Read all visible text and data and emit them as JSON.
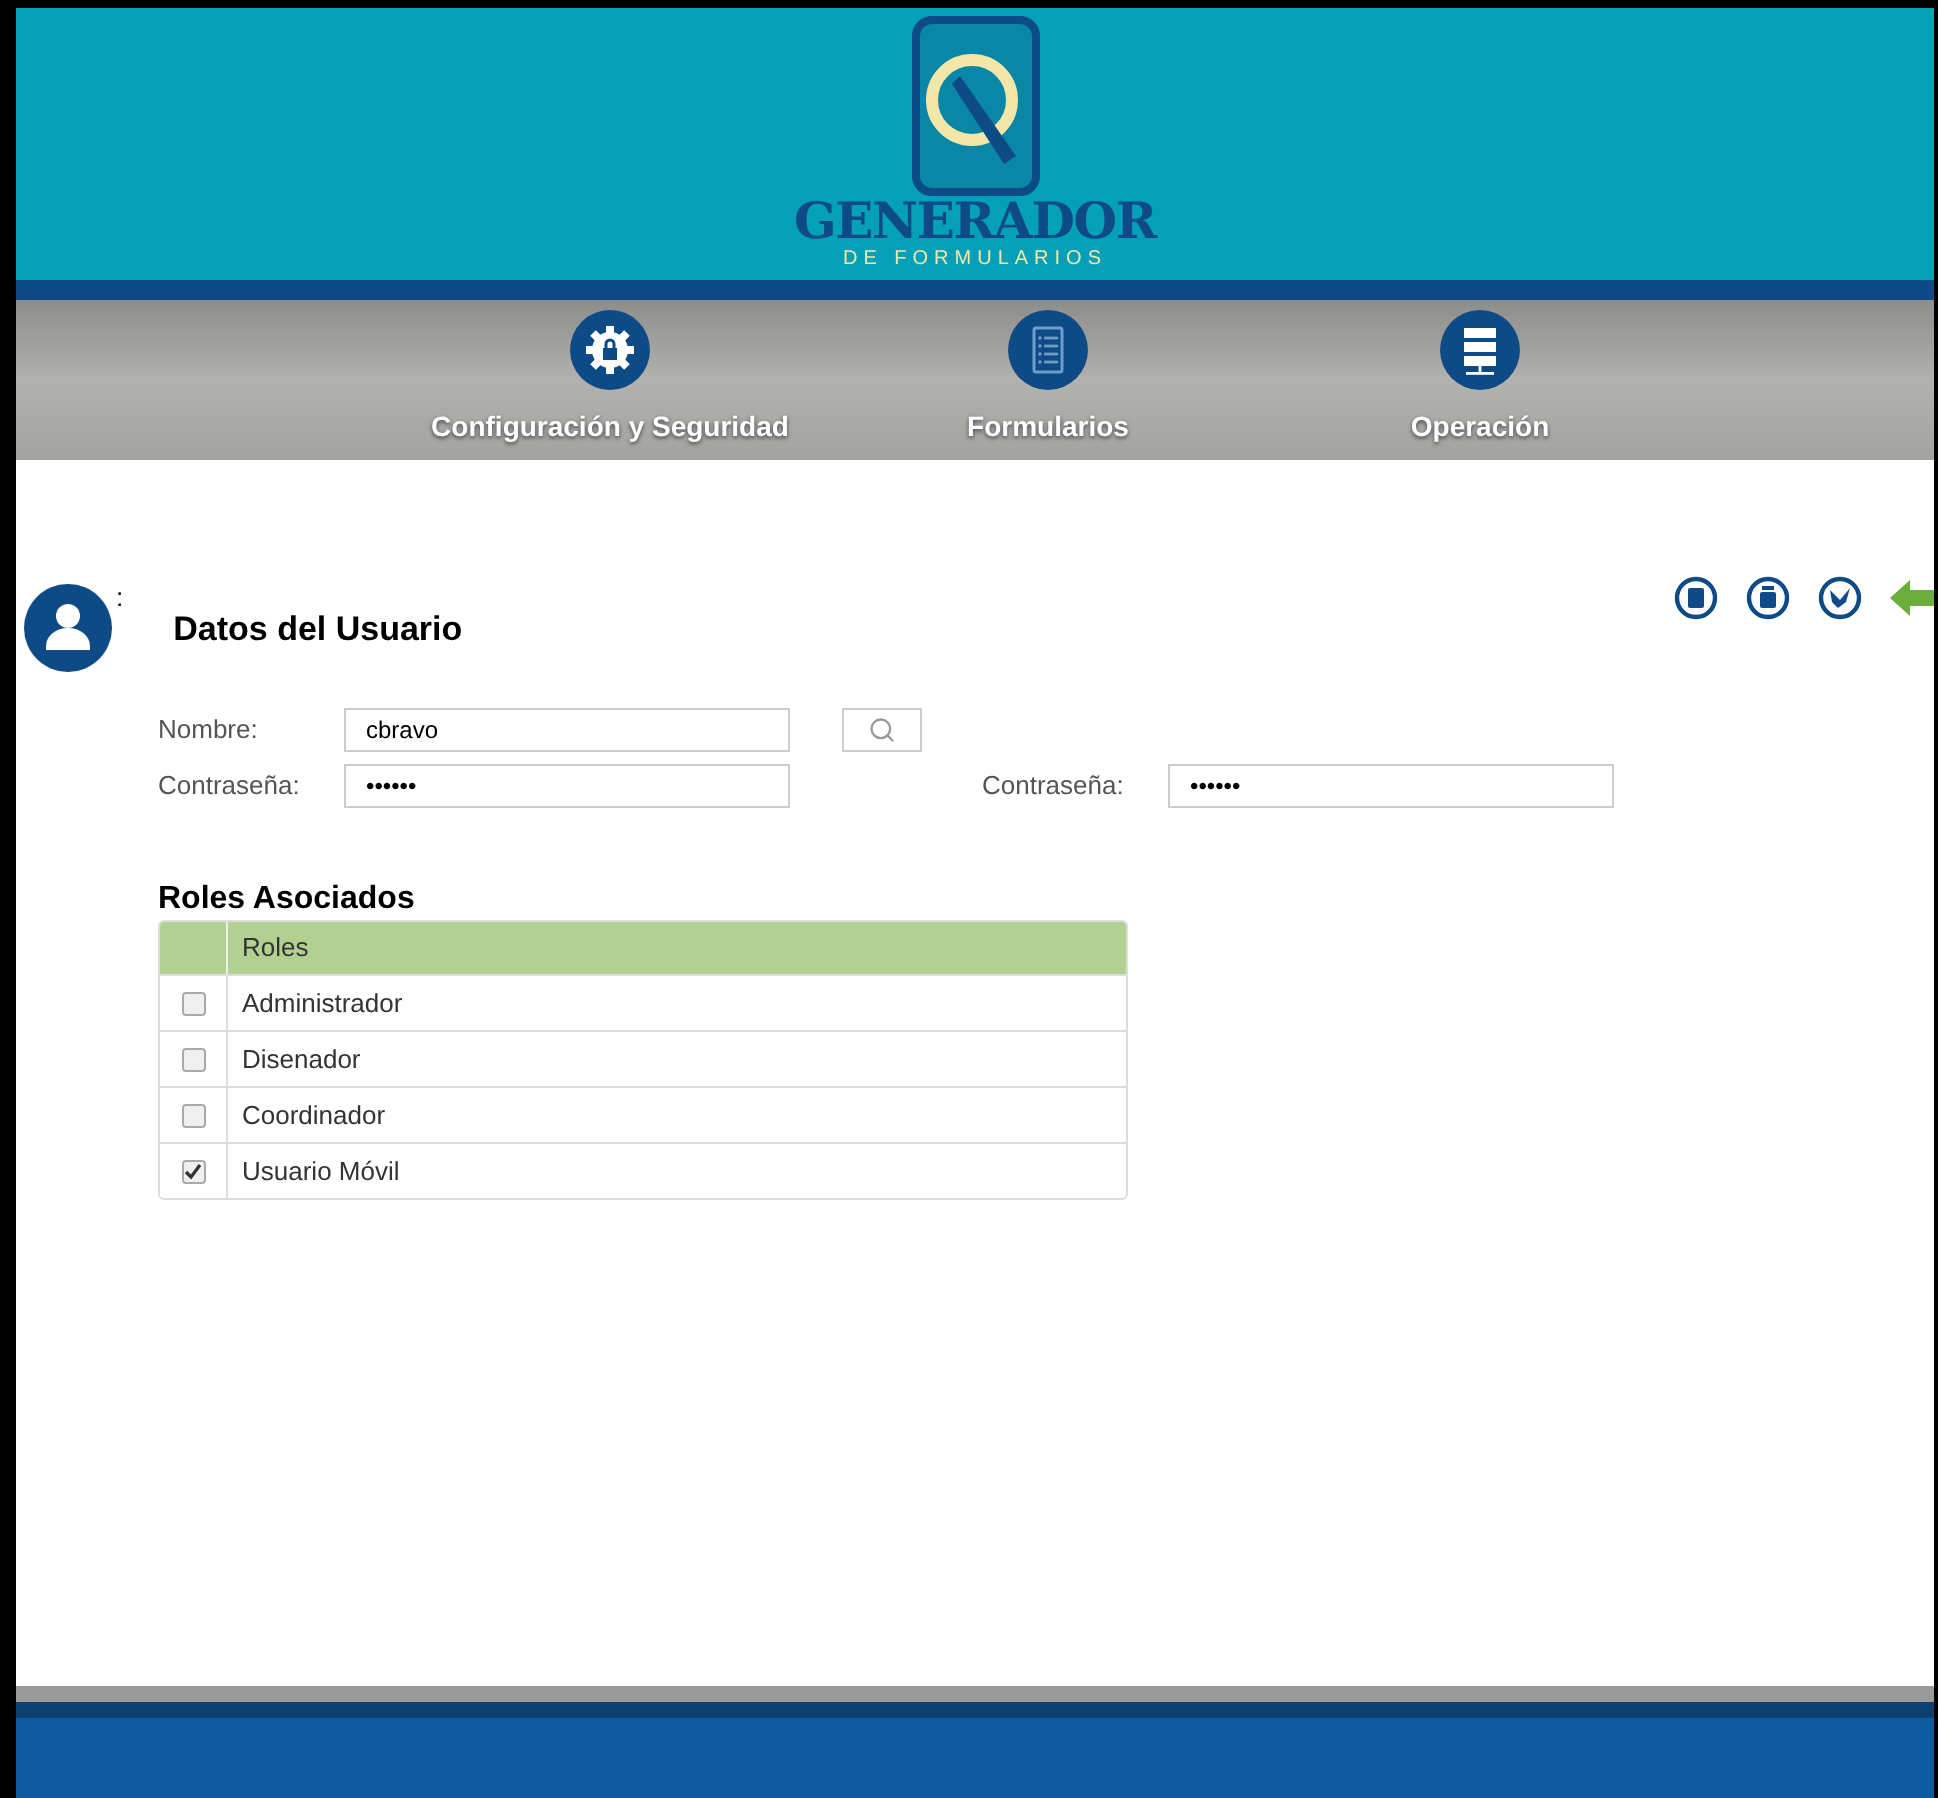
{
  "logo": {
    "title": "GENERADOR",
    "subtitle": "DE FORMULARIOS"
  },
  "nav": [
    {
      "label": "Configuración y Seguridad",
      "kind": "gear"
    },
    {
      "label": "Formularios",
      "kind": "document"
    },
    {
      "label": "Operación",
      "kind": "server"
    }
  ],
  "section": {
    "title": "Datos del Usuario",
    "separator": ":"
  },
  "toolbar": [
    {
      "kind": "save"
    },
    {
      "kind": "delete"
    },
    {
      "kind": "clean"
    },
    {
      "kind": "back"
    }
  ],
  "form": {
    "name_label": "Nombre:",
    "name_value": "cbravo",
    "password_label": "Contraseña:",
    "password_value": "••••••",
    "confirm_label": "Contraseña:",
    "confirm_value": "••••••"
  },
  "roles": {
    "title": "Roles Asociados",
    "column": "Roles",
    "rows": [
      {
        "name": "Administrador",
        "checked": false
      },
      {
        "name": "Disenador",
        "checked": false
      },
      {
        "name": "Coordinador",
        "checked": false
      },
      {
        "name": "Usuario Móvil",
        "checked": true
      }
    ]
  }
}
